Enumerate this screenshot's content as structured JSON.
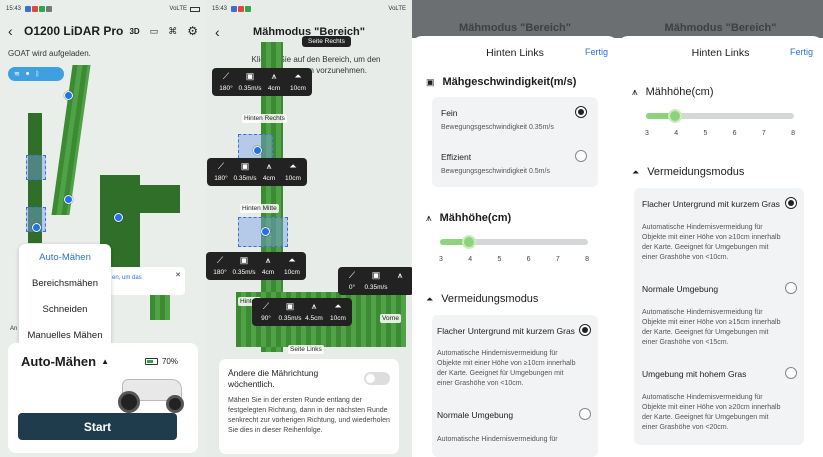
{
  "panel1": {
    "status": {
      "time": "15:43",
      "net": "VoLTE",
      "battery": "70"
    },
    "title": "O1200 LiDAR Pro",
    "header_icons": [
      "3d-view-icon",
      "camera-icon",
      "map-icon",
      "settings-icon"
    ],
    "notice": "GOAT wird aufgeladen.",
    "side_label": "An",
    "hint_text": "en, um das",
    "menu": [
      "Auto-Mähen",
      "Bereichsmähen",
      "Schneiden",
      "Manuelles Mähen"
    ],
    "mode_label": "Auto-Mähen",
    "battery_pct": "70%",
    "start_label": "Start"
  },
  "panel2": {
    "status": {
      "time": "15:43",
      "net": "VoLTE"
    },
    "title": "Mähmodus \"Bereich\"",
    "instruction": "Klicken Sie auf den Bereich, um den Anpassungen vorzunehmen.",
    "top_label": "Seite Rechts",
    "tooltips": [
      {
        "values": [
          "180°",
          "0.35m/s",
          "4cm",
          "10cm"
        ],
        "zone": "Hinten Rechts"
      },
      {
        "values": [
          "180°",
          "0.35m/s",
          "4cm",
          "10cm"
        ],
        "zone": "Hinten Mitte"
      },
      {
        "values": [
          "180°",
          "0.35m/s",
          "4cm",
          "10cm"
        ],
        "zone": "Hinten"
      },
      {
        "values": [
          "90°",
          "0.35m/s",
          "4.5cm",
          "10cm"
        ],
        "zone": "Seite Links"
      },
      {
        "values": [
          "0°",
          "0.35m/s",
          ""
        ],
        "zone": "Vorne"
      }
    ],
    "card": {
      "title": "Ändere die Mährichtung wöchentlich.",
      "desc": "Mähen Sie in der ersten Runde entlang der festgelegten Richtung, dann in der nächsten Runde senkrecht zur vorherigen Richtung, und wiederholen Sie dies in dieser Reihenfolge.",
      "toggle": false
    }
  },
  "panel3": {
    "behind_title": "Mähmodus \"Bereich\"",
    "header": "Hinten Links",
    "done": "Fertig",
    "speed_section": "Mähgeschwindigkeit(m/s)",
    "speed_options": [
      {
        "label": "Fein",
        "desc": "Bewegungsgeschwindigkeit 0.35m/s",
        "selected": true
      },
      {
        "label": "Effizient",
        "desc": "Bewegungsgeschwindigkeit 0.5m/s",
        "selected": false
      }
    ],
    "height_section": "Mähhöhe(cm)",
    "height_ticks": [
      "3",
      "4",
      "5",
      "6",
      "7",
      "8"
    ],
    "height_value": 4,
    "avoid_section": "Vermeidungsmodus",
    "avoid_options": [
      {
        "label": "Flacher Untergrund mit kurzem Gras",
        "desc": "Automatische Hindernisvermeidung für Objekte mit einer Höhe von ≥10cm innerhalb der Karte. Geeignet für Umgebungen mit einer Grashöhe von <10cm.",
        "selected": true
      },
      {
        "label": "Normale Umgebung",
        "desc": "Automatische Hindernisvermeidung für",
        "selected": false
      }
    ]
  },
  "panel4": {
    "behind_title": "Mähmodus \"Bereich\"",
    "header": "Hinten Links",
    "done": "Fertig",
    "height_section": "Mähhöhe(cm)",
    "height_ticks": [
      "3",
      "4",
      "5",
      "6",
      "7",
      "8"
    ],
    "height_value": 4,
    "avoid_section": "Vermeidungsmodus",
    "avoid_options": [
      {
        "label": "Flacher Untergrund mit kurzem Gras",
        "desc": "Automatische Hindernisvermeidung für Objekte mit einer Höhe von ≥10cm innerhalb der Karte. Geeignet für Umgebungen mit einer Grashöhe von <10cm.",
        "selected": true
      },
      {
        "label": "Normale Umgebung",
        "desc": "Automatische Hindernisvermeidung für Objekte mit einer Höhe von ≥15cm innerhalb der Karte. Geeignet für Umgebungen mit einer Grashöhe von <15cm.",
        "selected": false
      },
      {
        "label": "Umgebung mit hohem Gras",
        "desc": "Automatische Hindernisvermeidung für Objekte mit einer Höhe von ≥20cm innerhalb der Karte. Geeignet für Umgebungen mit einer Grashöhe von <20cm.",
        "selected": false
      }
    ]
  },
  "colors": {
    "accent": "#2a6fe0",
    "grass": "#3c8b33",
    "slider": "#8fd27d",
    "start_btn": "#1f3c4c"
  }
}
